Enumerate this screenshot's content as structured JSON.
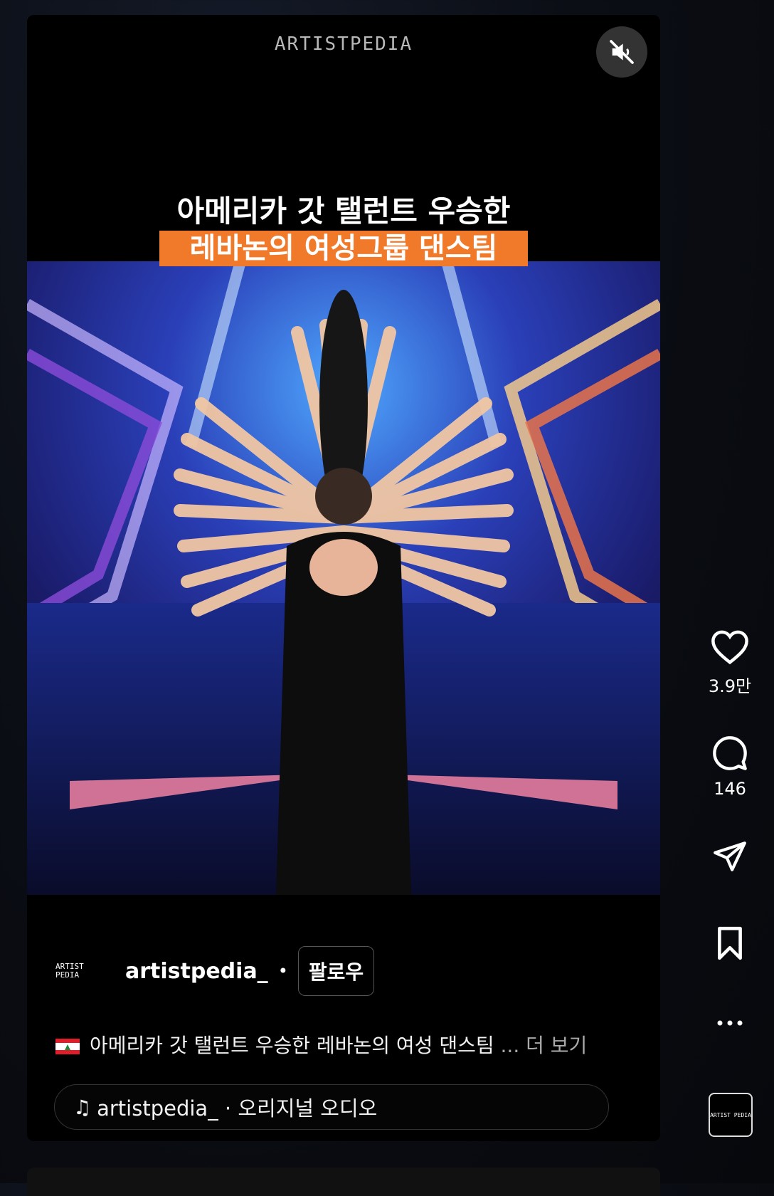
{
  "video": {
    "watermark": "ARTISTPEDIA",
    "caption_line1": "아메리카 갓 탤런트 우승한",
    "caption_line2": "레바논의 여성그룹 댄스팀",
    "muted": true
  },
  "post": {
    "avatar_text": "ARTIST PEDIA",
    "username": "artistpedia_",
    "separator": "•",
    "follow_label": "팔로우",
    "flag": "lebanon-flag",
    "description": "아메리카 갓 탤런트 우승한 레바논의 여성 댄스팀",
    "more_label": "... 더 보기",
    "audio_text": "artistpedia_ · 오리지널 오디오"
  },
  "actions": {
    "likes": "3.9만",
    "comments": "146",
    "audio_thumb_text": "ARTIST PEDIA"
  },
  "colors": {
    "caption_highlight": "#f07a2a",
    "background": "#000000",
    "accent_text": "#ffffff"
  }
}
